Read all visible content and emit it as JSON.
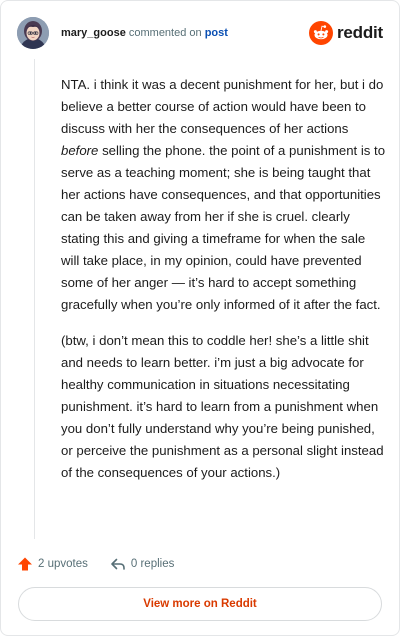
{
  "header": {
    "username": "mary_goose",
    "action_text": "commented on",
    "post_link": "post",
    "brand": "reddit",
    "brand_color": "#FF4500"
  },
  "comment": {
    "p1_before_em": "NTA. i think it was a decent punishment for her, but i do believe a better course of action would have been to discuss with her the consequences of her actions ",
    "p1_em": "before",
    "p1_after_em": " selling the phone. the point of a punishment is to serve as a teaching moment; she is being taught that her actions have consequences, and that opportunities can be taken away from her if she is cruel. clearly stating this and giving a timeframe for when the sale will take place, in my opinion, could have prevented some of her anger — it’s hard to accept something gracefully when you’re only informed of it after the fact.",
    "p2": "(btw, i don’t mean this to coddle her! she’s a little shit and needs to learn better. i’m just a big advocate for healthy communication in situations necessitating punishment. it’s hard to learn from a punishment when you don’t fully understand why you’re being punished, or perceive the punishment as a personal slight instead of the consequences of your actions.)"
  },
  "actions": {
    "upvotes": "2 upvotes",
    "replies": "0 replies",
    "upvote_color": "#FF4500"
  },
  "footer": {
    "view_more": "View more on Reddit",
    "link_color": "#D93A00"
  }
}
